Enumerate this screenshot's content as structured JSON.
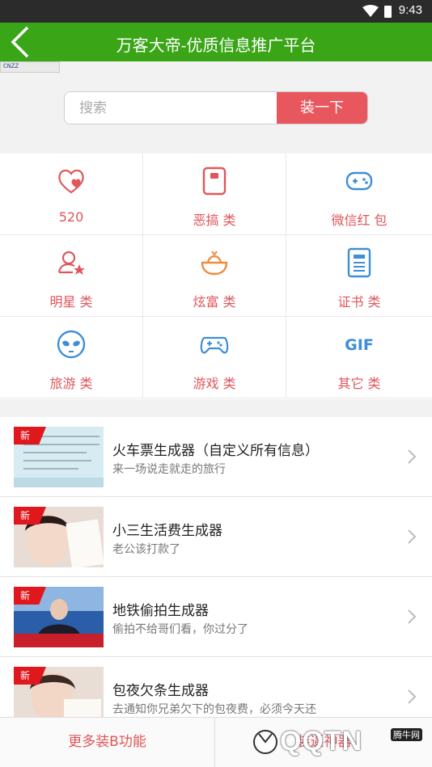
{
  "status_bar": {
    "time": "9:43"
  },
  "header": {
    "title": "万客大帝-优质信息推广平台"
  },
  "cnzz_badge": "CNZZ",
  "search": {
    "placeholder": "搜索",
    "button_label": "装一下"
  },
  "categories": [
    {
      "label": "520",
      "icon": "heart-icon"
    },
    {
      "label": "恶搞 类",
      "icon": "prank-box-icon"
    },
    {
      "label": "微信红 包",
      "icon": "gamepad-icon"
    },
    {
      "label": "明星 类",
      "icon": "star-person-icon"
    },
    {
      "label": "炫富 类",
      "icon": "money-bowl-icon"
    },
    {
      "label": "证书 类",
      "icon": "certificate-icon"
    },
    {
      "label": "旅游 类",
      "icon": "alien-face-icon"
    },
    {
      "label": "游戏 类",
      "icon": "game-controller-icon"
    },
    {
      "label": "其它 类",
      "icon": "gif-icon"
    }
  ],
  "list": [
    {
      "tag": "新",
      "title": "火车票生成器（自定义所有信息）",
      "subtitle": "来一场说走就走的旅行"
    },
    {
      "tag": "新",
      "title": "小三生活费生成器",
      "subtitle": "老公该打款了"
    },
    {
      "tag": "新",
      "title": "地铁偷拍生成器",
      "subtitle": "偷拍不给哥们看，你过分了"
    },
    {
      "tag": "新",
      "title": "包夜欠条生成器",
      "subtitle": "去通知你兄弟欠下的包夜费，必须今天还"
    }
  ],
  "bottom_tabs": {
    "left": "更多装B功能",
    "right": "装逼神器"
  },
  "watermark": {
    "main": "QQTN",
    "sub": "腾牛网"
  },
  "colors": {
    "accent_green": "#3aa517",
    "accent_red": "#e9575e",
    "label_red": "#e0565b",
    "icon_blue": "#3e8ed8",
    "icon_orange": "#f08a3c"
  }
}
